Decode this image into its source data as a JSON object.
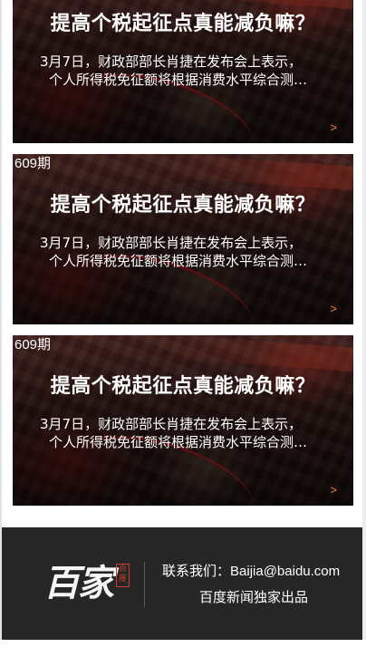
{
  "cards": [
    {
      "issue": "",
      "title": "提高个税起征点真能减负嘛？",
      "summary_line1": "3月7日，财政部部长肖捷在发布会上表示，",
      "summary_line2": "个人所得税免征额将根据消费水平综合测…",
      "arrow": ">"
    },
    {
      "issue": "609期",
      "title": "提高个税起征点真能减负嘛？",
      "summary_line1": "3月7日，财政部部长肖捷在发布会上表示，",
      "summary_line2": "个人所得税免征额将根据消费水平综合测…",
      "arrow": ">"
    },
    {
      "issue": "609期",
      "title": "提高个税起征点真能减负嘛？",
      "summary_line1": "3月7日，财政部部长肖捷在发布会上表示，",
      "summary_line2": "个人所得税免征额将根据消费水平综合测…",
      "arrow": ">"
    }
  ],
  "footer": {
    "logo_text": "百家",
    "logo_stamp": "百度",
    "contact_label": "联系我们：",
    "contact_email": "Baijia@baidu.com",
    "credit": "百度新闻独家出品"
  },
  "colors": {
    "arrow": "#e8785a",
    "footer_bg": "#262626",
    "stamp": "#c8402e"
  }
}
